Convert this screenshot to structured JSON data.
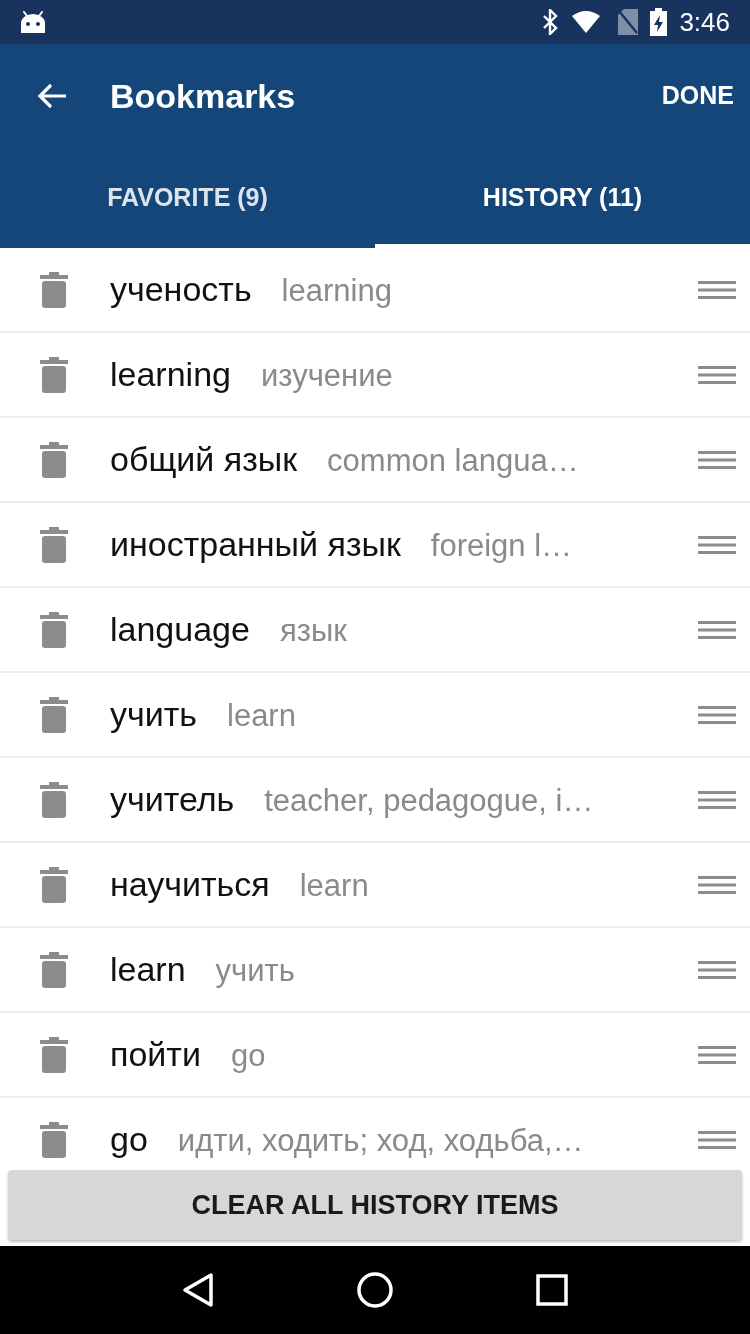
{
  "status_bar": {
    "time": "3:46"
  },
  "app_bar": {
    "title": "Bookmarks",
    "action": "DONE"
  },
  "tabs": [
    {
      "label": "FAVORITE (9)",
      "selected": false
    },
    {
      "label": "HISTORY (11)",
      "selected": true
    }
  ],
  "history_items": [
    {
      "word": "ученость",
      "translation": "learning"
    },
    {
      "word": "learning",
      "translation": "изучение"
    },
    {
      "word": "общий язык",
      "translation": "common langua…"
    },
    {
      "word": "иностранный язык",
      "translation": "foreign l…"
    },
    {
      "word": "language",
      "translation": "язык"
    },
    {
      "word": "учить",
      "translation": "learn"
    },
    {
      "word": "учитель",
      "translation": "teacher, pedagogue, i…"
    },
    {
      "word": "научиться",
      "translation": "learn"
    },
    {
      "word": "learn",
      "translation": "учить"
    },
    {
      "word": "пойти",
      "translation": "go"
    },
    {
      "word": "go",
      "translation": "идти, ходить; ход, ходьба,…"
    }
  ],
  "clear_button": {
    "label": "CLEAR ALL HISTORY ITEMS"
  }
}
